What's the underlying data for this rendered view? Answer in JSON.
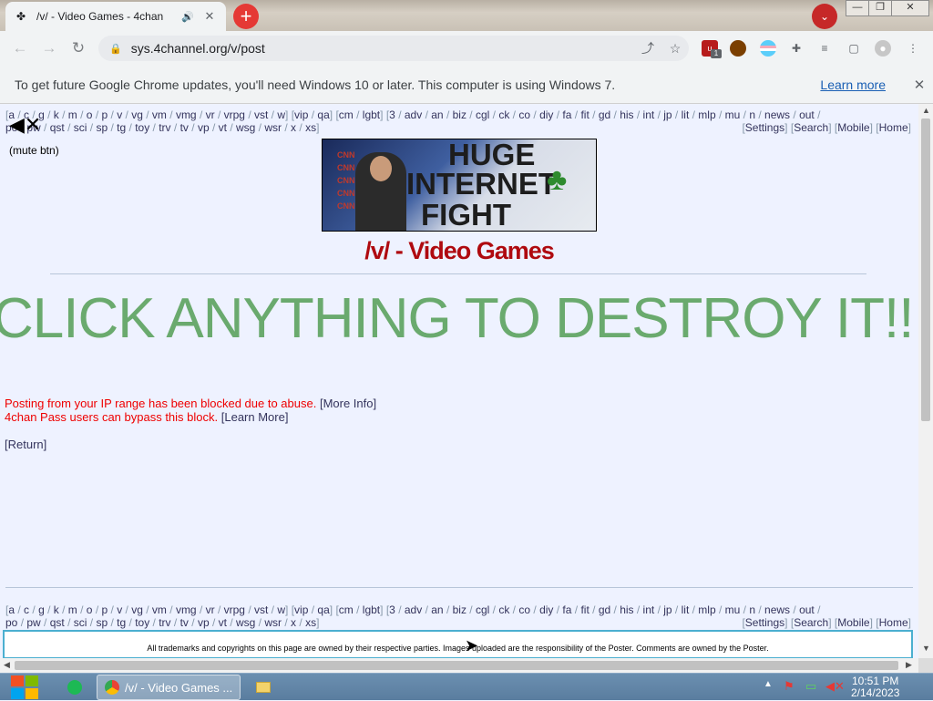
{
  "browser": {
    "tab_title": "/v/ - Video Games - 4chan",
    "tab_icon": "4chan-clover",
    "tab_audio_icon": "🔊",
    "tab_close": "✕",
    "new_tab": "+",
    "tab_list": "⌄",
    "window_minimize": "—",
    "window_maximize": "❐",
    "window_close": "✕",
    "url": "sys.4channel.org/v/post",
    "nav_back": "←",
    "nav_forward": "→",
    "nav_reload": "↻",
    "lock": "🔒",
    "share_icon": "⤴",
    "star_icon": "☆",
    "extension_badge": "1",
    "menu_icon": "⋮"
  },
  "infobar": {
    "message": "To get future Google Chrome updates, you'll need Windows 10 or later. This computer is using Windows 7.",
    "learn_more": "Learn more",
    "close": "✕"
  },
  "board_nav": {
    "line1": [
      "a",
      "c",
      "g",
      "k",
      "m",
      "o",
      "p",
      "v",
      "vg",
      "vm",
      "vmg",
      "vr",
      "vrpg",
      "vst",
      "w"
    ],
    "line1b": [
      "vip",
      "qa"
    ],
    "line1c": [
      "cm",
      "lgbt"
    ],
    "line1d": [
      "3",
      "adv",
      "an",
      "biz",
      "cgl",
      "ck",
      "co",
      "diy",
      "fa",
      "fit",
      "gd",
      "his",
      "int",
      "jp",
      "lit",
      "mlp",
      "mu",
      "n",
      "news",
      "out"
    ],
    "line2": [
      "po",
      "pw",
      "qst",
      "sci",
      "sp",
      "tg",
      "toy",
      "trv",
      "tv",
      "vp",
      "vt",
      "wsg",
      "wsr",
      "x",
      "xs"
    ],
    "right": [
      "Settings",
      "Search",
      "Mobile",
      "Home"
    ]
  },
  "page": {
    "mute_label": "(mute btn)",
    "banner_text": [
      "HUGE",
      "INTERNET",
      "FIGHT"
    ],
    "board_title": "/v/ - Video Games",
    "destroy_text": "CLICK ANYTHING TO DESTROY IT!!",
    "error_line1": "Posting from your IP range has been blocked due to abuse.",
    "error_more_info": "[More Info]",
    "error_line2": "4chan Pass users can bypass this block.",
    "error_learn_more": "[Learn More]",
    "return": "[Return]",
    "footer": "All trademarks and copyrights on this page are owned by their respective parties. Images uploaded are the responsibility of the Poster. Comments are owned by the Poster."
  },
  "taskbar": {
    "chrome_label": "/v/ - Video Games ...",
    "clock_time": "10:51 PM",
    "clock_date": "2/14/2023"
  }
}
